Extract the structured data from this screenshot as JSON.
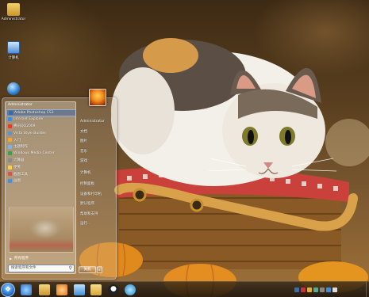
{
  "desktop": {
    "icons": [
      {
        "label": "Administrator"
      },
      {
        "label": "计算机"
      },
      {
        "label": ""
      }
    ]
  },
  "start_menu": {
    "user_name": "Administrator",
    "programs": [
      {
        "label": "Adobe Photoshop CS3",
        "icon_color": "#2a6fb3"
      },
      {
        "label": "Internet Explorer",
        "icon_color": "#3a8ee6"
      },
      {
        "label": "腾讯QQ2009",
        "icon_color": "#e83b2b"
      },
      {
        "label": "Vista Style Builder",
        "icon_color": "#6b8fc0"
      },
      {
        "label": "入门",
        "icon_color": "#f0a830"
      },
      {
        "label": "主题制作",
        "icon_color": "#7db3e0"
      },
      {
        "label": "Windows Media Center",
        "icon_color": "#3aa050"
      },
      {
        "label": "计算器",
        "icon_color": "#8a8a8a"
      },
      {
        "label": "便笺",
        "icon_color": "#f2d34a"
      },
      {
        "label": "截图工具",
        "icon_color": "#d9534f"
      },
      {
        "label": "画图",
        "icon_color": "#4a90d9"
      }
    ],
    "all_programs_label": "所有程序",
    "search_placeholder": "搜索程序和文件",
    "right_items": [
      {
        "label": "Administrator"
      },
      {
        "label": "文档"
      },
      {
        "label": "图片"
      },
      {
        "label": "音乐"
      },
      {
        "label": "游戏"
      },
      {
        "label": "计算机"
      },
      {
        "label": "控制面板"
      },
      {
        "label": "设备和打印机"
      },
      {
        "label": "默认程序"
      },
      {
        "label": "帮助和支持"
      },
      {
        "label": "运行..."
      }
    ],
    "shutdown_label": "关机"
  },
  "taskbar": {
    "pinned": [
      {
        "name": "ie",
        "color": "#3a8ee6"
      },
      {
        "name": "explorer",
        "color": "#e8b84a"
      },
      {
        "name": "media",
        "color": "#f29a2e"
      },
      {
        "name": "network",
        "color": "#5aa7e0"
      },
      {
        "name": "folder",
        "color": "#f1c553"
      },
      {
        "name": "qq",
        "color": "#222"
      },
      {
        "name": "swirl",
        "color": "#36a3d9"
      }
    ],
    "time": "",
    "date": ""
  }
}
